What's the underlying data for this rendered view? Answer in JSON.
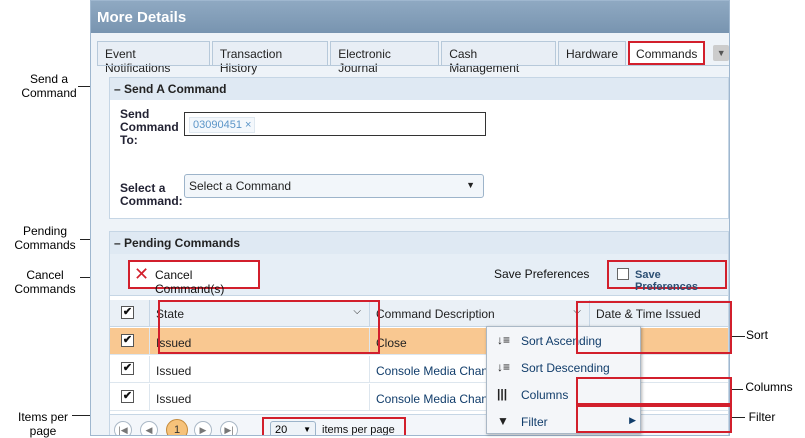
{
  "window": {
    "title": "More Details"
  },
  "tabs": [
    "Event Notifications",
    "Transaction History",
    "Electronic Journal",
    "Cash Management",
    "Hardware",
    "Commands"
  ],
  "send_command": {
    "header": "Send A Command",
    "send_to_label": "Send Command To:",
    "recipient": "03090451",
    "select_label": "Select a Command:",
    "select_value": "Select a Command"
  },
  "pending": {
    "header": "Pending Commands",
    "cancel_label": "Cancel Command(s)",
    "save_prefs_text": "Save Preferences",
    "save_prefs_button": "Save Preferences",
    "columns": [
      "State",
      "Command Description",
      "Date & Time Issued"
    ],
    "rows": [
      {
        "state": "Issued",
        "description": "Close"
      },
      {
        "state": "Issued",
        "description": "Console Media Change"
      },
      {
        "state": "Issued",
        "description": "Console Media Change"
      }
    ],
    "page": "1",
    "page_size": "20",
    "items_per_page": "items per page"
  },
  "column_menu": {
    "items": [
      "Sort Ascending",
      "Sort Descending",
      "Columns",
      "Filter"
    ]
  },
  "callouts": {
    "send_a_command": "Send a Command",
    "pending_commands": "Pending Commands",
    "cancel_commands": "Cancel Commands",
    "items_per_page": "Items per page",
    "sort": "Sort",
    "columns": "Columns",
    "filter": "Filter"
  },
  "colors": {
    "highlight": "#d21f2c",
    "selected_row": "#f9c891",
    "title_bar": "#8fa9c2"
  }
}
